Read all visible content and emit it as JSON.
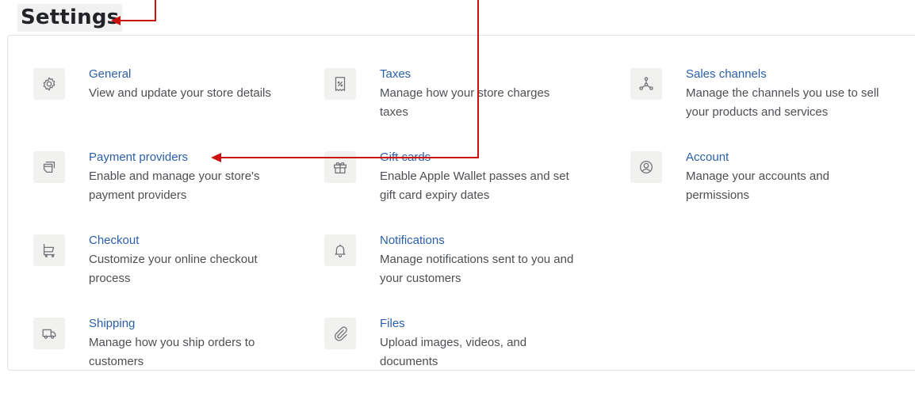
{
  "page": {
    "title": "Settings"
  },
  "settings": {
    "items": [
      {
        "icon": "gear-icon",
        "title": "General",
        "description": "View and update your store details"
      },
      {
        "icon": "tax-receipt-icon",
        "title": "Taxes",
        "description": "Manage how your store charges taxes"
      },
      {
        "icon": "sales-channels-icon",
        "title": "Sales channels",
        "description": "Manage the channels you use to sell your products and services"
      },
      {
        "icon": "payment-card-icon",
        "title": "Payment providers",
        "description": "Enable and manage your store's payment providers"
      },
      {
        "icon": "gift-icon",
        "title": "Gift cards",
        "description": "Enable Apple Wallet passes and set gift card expiry dates"
      },
      {
        "icon": "account-icon",
        "title": "Account",
        "description": "Manage your accounts and permissions"
      },
      {
        "icon": "cart-icon",
        "title": "Checkout",
        "description": "Customize your online checkout process"
      },
      {
        "icon": "bell-icon",
        "title": "Notifications",
        "description": "Manage notifications sent to you and your customers"
      },
      {
        "icon": "truck-icon",
        "title": "Shipping",
        "description": "Manage how you ship orders to customers"
      },
      {
        "icon": "paperclip-icon",
        "title": "Files",
        "description": "Upload images, videos, and documents"
      }
    ]
  },
  "annotation": {
    "arrow_color": "#cc1111"
  }
}
